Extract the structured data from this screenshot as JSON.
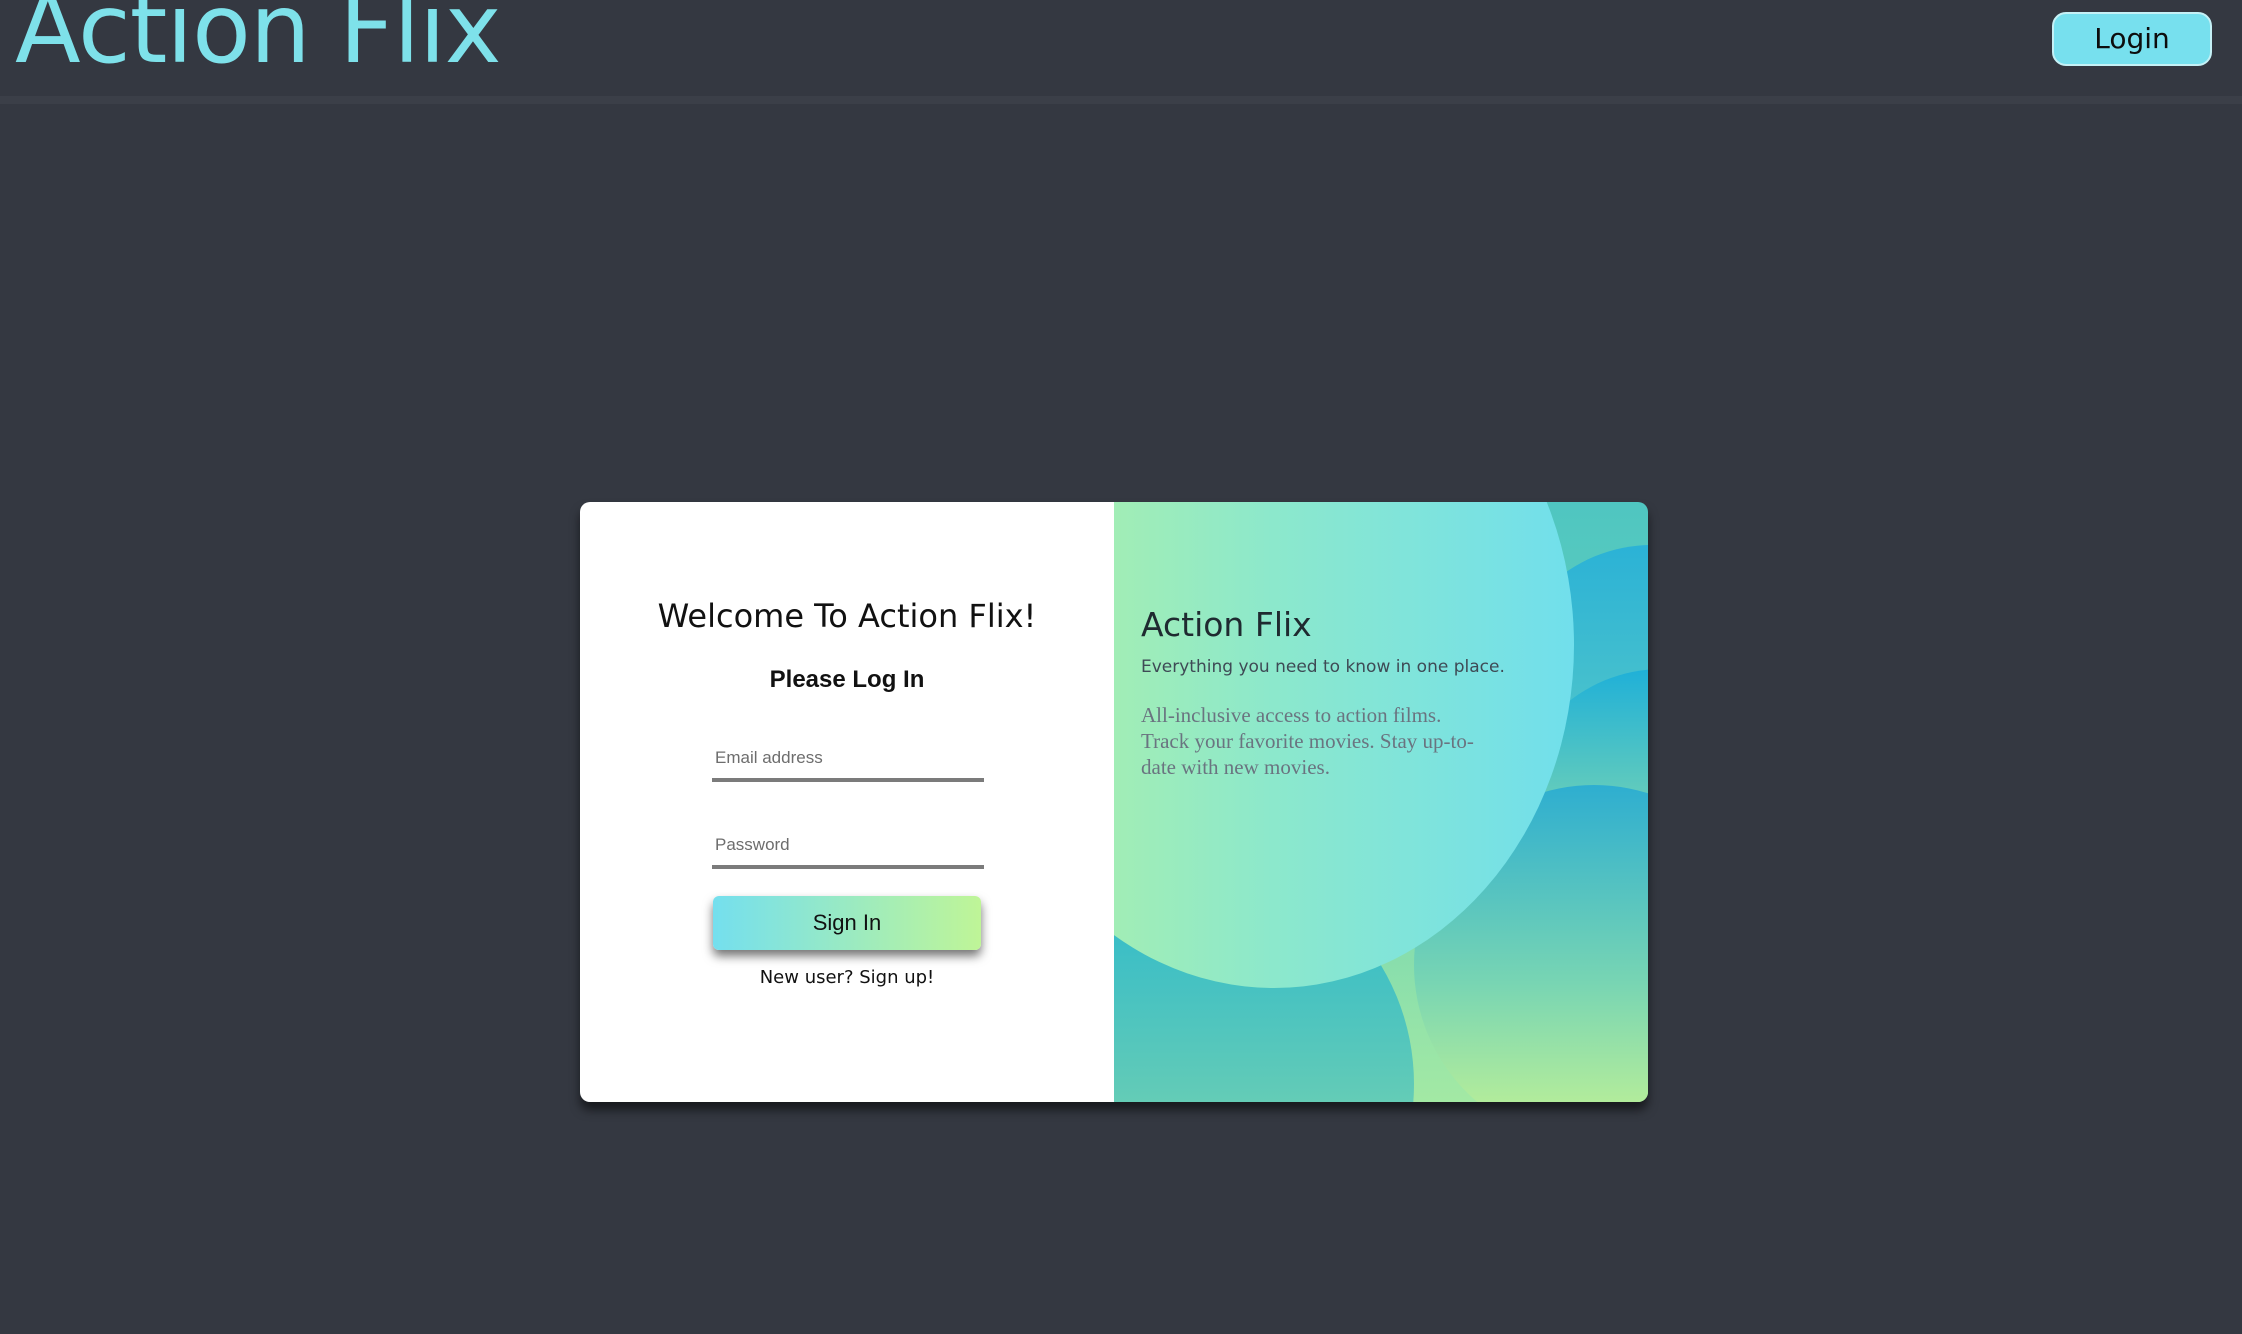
{
  "header": {
    "brand": "Action Flix",
    "login_label": "Login"
  },
  "login_form": {
    "welcome": "Welcome To Action Flix!",
    "subtitle": "Please Log In",
    "email_placeholder": "Email address",
    "password_placeholder": "Password",
    "submit_label": "Sign In",
    "signup_link": "New user? Sign up!"
  },
  "promo": {
    "title": "Action Flix",
    "tagline": "Everything you need to know in one place.",
    "description": "All-inclusive access to action films. Track your favorite movies. Stay up-to-date with new movies."
  },
  "colors": {
    "background": "#343841",
    "brand": "#7ee1ea",
    "login_button": "#77e0ee",
    "gradient_start": "#74dfee",
    "gradient_end": "#bff597"
  }
}
